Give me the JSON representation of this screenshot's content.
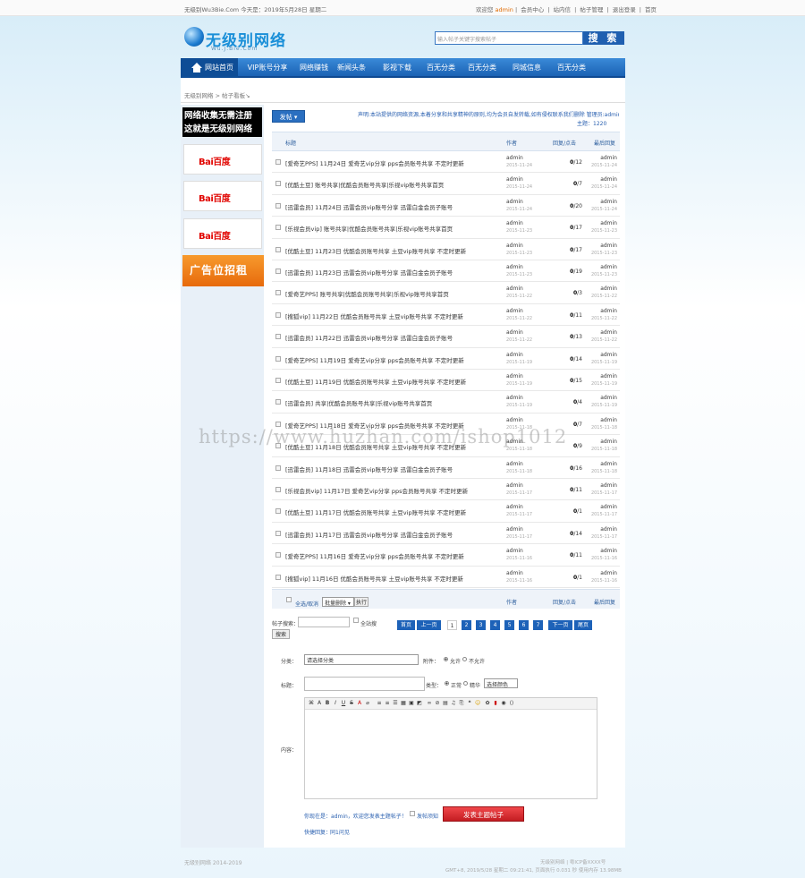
{
  "topbar": {
    "left": "无级别Wu3Bie.Com 今天是：2019年5月28日 星期二",
    "welcome": "欢迎您",
    "user": "admin",
    "links": [
      "会员中心",
      "站内信",
      "帖子管理",
      "退出登录",
      "首页"
    ]
  },
  "logo": {
    "main": "无级别网络",
    "sub": "Wu.J.Bie.Com"
  },
  "search": {
    "placeholder": "输入帖子关键字搜索帖子",
    "button": "搜 索"
  },
  "nav": [
    "网站首页",
    "VIP账号分享",
    "网络赚钱",
    "新闻头条",
    "影视下载",
    "百无分类",
    "百无分类",
    "同城信息",
    "百无分类"
  ],
  "breadcrumb": "无级别网络 > 帖子看板↘",
  "sidebar": {
    "ad_top_line1": "网络收集无需注册",
    "ad_top_line2": "这就是无级别网络",
    "baidu": [
      "Bai百度",
      "Bai百度",
      "Bai百度"
    ],
    "ad_bottom": "广告位招租"
  },
  "board": {
    "post_button": "发帖 ▾",
    "notice": "声明:本站提供的网络资源,本着分享和共享精神的原则,均为会员自发转载,如有侵权联系我们删除 管理员:admin wujbie",
    "moderator": "主题：1220"
  },
  "thead": {
    "title": "标题",
    "author": "作者",
    "replies": "回复/点击",
    "last": "最后回复"
  },
  "threads": [
    {
      "title": "[爱奇艺PPS] 11月24日 爱奇艺vip分享 pps会员账号共享 不定时更新",
      "author": "admin",
      "date": "2015-11-24",
      "replies": "0",
      "views": "12",
      "last": "admin",
      "last_date": "2015-11-24"
    },
    {
      "title": "[优酷土豆] 账号共享|优酷会员账号共享|乐视vip账号共享首页",
      "author": "admin",
      "date": "2015-11-24",
      "replies": "0",
      "views": "7",
      "last": "admin",
      "last_date": "2015-11-24"
    },
    {
      "title": "[迅雷会员] 11月24日 迅雷会员vip账号分享 迅雷白金会员子账号",
      "author": "admin",
      "date": "2015-11-24",
      "replies": "0",
      "views": "20",
      "last": "admin",
      "last_date": "2015-11-24"
    },
    {
      "title": "[乐视会员vip] 账号共享|优酷会员账号共享|乐视vip账号共享首页",
      "author": "admin",
      "date": "2015-11-23",
      "replies": "0",
      "views": "17",
      "last": "admin",
      "last_date": "2015-11-23"
    },
    {
      "title": "[优酷土豆] 11月23日 优酷会员账号共享 土豆vip账号共享 不定时更新",
      "author": "admin",
      "date": "2015-11-23",
      "replies": "0",
      "views": "17",
      "last": "admin",
      "last_date": "2015-11-23"
    },
    {
      "title": "[迅雷会员] 11月23日 迅雷会员vip账号分享 迅雷白金会员子账号",
      "author": "admin",
      "date": "2015-11-23",
      "replies": "0",
      "views": "19",
      "last": "admin",
      "last_date": "2015-11-23"
    },
    {
      "title": "[爱奇艺PPS] 账号共享|优酷会员账号共享|乐视vip账号共享首页",
      "author": "admin",
      "date": "2015-11-22",
      "replies": "0",
      "views": "3",
      "last": "admin",
      "last_date": "2015-11-22"
    },
    {
      "title": "[搜狐vip] 11月22日 优酷会员账号共享 土豆vip账号共享 不定时更新",
      "author": "admin",
      "date": "2015-11-22",
      "replies": "0",
      "views": "11",
      "last": "admin",
      "last_date": "2015-11-22"
    },
    {
      "title": "[迅雷会员] 11月22日 迅雷会员vip账号分享 迅雷白金会员子账号",
      "author": "admin",
      "date": "2015-11-22",
      "replies": "0",
      "views": "13",
      "last": "admin",
      "last_date": "2015-11-22"
    },
    {
      "title": "[爱奇艺PPS] 11月19日 爱奇艺vip分享 pps会员账号共享 不定时更新",
      "author": "admin",
      "date": "2015-11-19",
      "replies": "0",
      "views": "14",
      "last": "admin",
      "last_date": "2015-11-19"
    },
    {
      "title": "[优酷土豆] 11月19日 优酷会员账号共享 土豆vip账号共享 不定时更新",
      "author": "admin",
      "date": "2015-11-19",
      "replies": "0",
      "views": "15",
      "last": "admin",
      "last_date": "2015-11-19"
    },
    {
      "title": "[迅雷会员] 共享|优酷会员账号共享|乐视vip账号共享首页",
      "author": "admin",
      "date": "2015-11-19",
      "replies": "0",
      "views": "4",
      "last": "admin",
      "last_date": "2015-11-19"
    },
    {
      "title": "[爱奇艺PPS] 11月18日 爱奇艺vip分享 pps会员账号共享 不定时更新",
      "author": "admin",
      "date": "2015-11-18",
      "replies": "0",
      "views": "7",
      "last": "admin",
      "last_date": "2015-11-18"
    },
    {
      "title": "[优酷土豆] 11月18日 优酷会员账号共享 土豆vip账号共享 不定时更新",
      "author": "admin",
      "date": "2015-11-18",
      "replies": "0",
      "views": "9",
      "last": "admin",
      "last_date": "2015-11-18"
    },
    {
      "title": "[迅雷会员] 11月18日 迅雷会员vip账号分享 迅雷白金会员子账号",
      "author": "admin",
      "date": "2015-11-18",
      "replies": "0",
      "views": "16",
      "last": "admin",
      "last_date": "2015-11-18"
    },
    {
      "title": "[乐视会员vip] 11月17日 爱奇艺vip分享 pps会员账号共享 不定时更新",
      "author": "admin",
      "date": "2015-11-17",
      "replies": "0",
      "views": "11",
      "last": "admin",
      "last_date": "2015-11-17"
    },
    {
      "title": "[优酷土豆] 11月17日 优酷会员账号共享 土豆vip账号共享 不定时更新",
      "author": "admin",
      "date": "2015-11-17",
      "replies": "0",
      "views": "1",
      "last": "admin",
      "last_date": "2015-11-17"
    },
    {
      "title": "[迅雷会员] 11月17日 迅雷会员vip账号分享 迅雷白金会员子账号",
      "author": "admin",
      "date": "2015-11-17",
      "replies": "0",
      "views": "14",
      "last": "admin",
      "last_date": "2015-11-17"
    },
    {
      "title": "[爱奇艺PPS] 11月16日 爱奇艺vip分享 pps会员账号共享 不定时更新",
      "author": "admin",
      "date": "2015-11-16",
      "replies": "0",
      "views": "11",
      "last": "admin",
      "last_date": "2015-11-16"
    },
    {
      "title": "[搜狐vip] 11月16日 优酷会员账号共享 土豆vip账号共享 不定时更新",
      "author": "admin",
      "date": "2015-11-16",
      "replies": "0",
      "views": "1",
      "last": "admin",
      "last_date": "2015-11-16"
    }
  ],
  "tfoot": {
    "select_all": "全选/取消",
    "batch": "批量删除 ▾",
    "exec": "执行",
    "author": "作者",
    "replies": "回复/点击",
    "last": "最后回复"
  },
  "search_box": {
    "label": "帖子搜索：",
    "check": "全站搜",
    "button": "搜索"
  },
  "pager": {
    "first": "首页",
    "prev": "上一页",
    "pages": [
      "1",
      "2",
      "3",
      "4",
      "5",
      "6",
      "7"
    ],
    "next": "下一页",
    "last": "尾页"
  },
  "form": {
    "category_label": "分类：",
    "category_value": "请选择分类",
    "attach_label": "附件：",
    "radio1": "允许",
    "radio2": "不允许",
    "title_label": "标题：",
    "type_label": "类型：",
    "radio3": "正常",
    "radio4": "精华",
    "type_value": "选择颜色",
    "content_label": "内容：",
    "hint": "你现在是：admin，欢迎您发表主题帖子！",
    "hint_check": "发帖须知",
    "submit": "发表主题帖子",
    "quick_label": "快捷回复：",
    "quick_value": "同1问见"
  },
  "footer": {
    "left": "无级别网络 2014-2019",
    "right1": "无级别网络 | 粤ICP备XXXX号",
    "right2": "GMT+8, 2019/5/28 星期二 09:21:41, 页面执行 0.031 秒 使用内存 13.98MB"
  },
  "watermark": "https://www.huzhan.com/ishop1012"
}
